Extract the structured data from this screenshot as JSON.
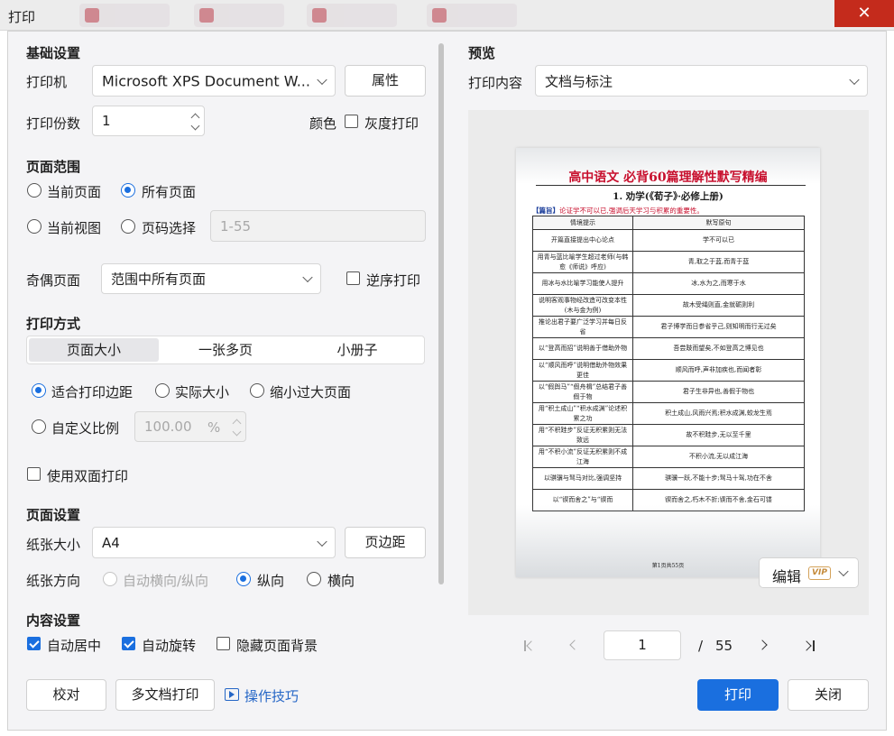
{
  "window": {
    "title": "打印",
    "close_glyph": "✕"
  },
  "left": {
    "basic": {
      "heading": "基础设置",
      "printer_label": "打印机",
      "printer_value": "Microsoft XPS Document W...",
      "properties_button": "属性",
      "copies_label": "打印份数",
      "copies_value": "1",
      "color_label": "颜色",
      "grayscale_label": "灰度打印",
      "grayscale_checked": false
    },
    "range": {
      "heading": "页面范围",
      "current_page": "当前页面",
      "all_pages": "所有页面",
      "current_view": "当前视图",
      "page_select": "页码选择",
      "page_select_placeholder": "1-55",
      "selected": "所有页面"
    },
    "oddeven": {
      "label": "奇偶页面",
      "value": "范围中所有页面",
      "reverse_label": "逆序打印",
      "reverse_checked": false
    },
    "mode": {
      "heading": "打印方式",
      "tabs": [
        "页面大小",
        "一张多页",
        "小册子"
      ],
      "active_tab": "页面大小",
      "fit_margin": "适合打印边距",
      "actual_size": "实际大小",
      "shrink_large": "缩小过大页面",
      "custom_scale": "自定义比例",
      "scale_value": "100.00",
      "scale_unit": "%",
      "duplex_label": "使用双面打印",
      "duplex_checked": false
    },
    "page": {
      "heading": "页面设置",
      "paper_label": "纸张大小",
      "paper_value": "A4",
      "margins_button": "页边距",
      "orientation_label": "纸张方向",
      "auto_orientation": "自动横向/纵向",
      "portrait": "纵向",
      "landscape": "横向",
      "selected": "纵向"
    },
    "content": {
      "heading": "内容设置",
      "auto_center": "自动居中",
      "auto_center_checked": true,
      "auto_rotate": "自动旋转",
      "auto_rotate_checked": true,
      "hide_bg": "隐藏页面背景",
      "hide_bg_checked": false
    }
  },
  "preview": {
    "heading": "预览",
    "content_label": "打印内容",
    "content_value": "文档与标注",
    "document": {
      "title": "高中语文 必背60篇理解性默写精编",
      "subtitle": "1. 劝学(《荀子》·必修上册)",
      "note_tag": "【篇旨】",
      "note": "论证学不可以已,强调后天学习与积累的重要性。",
      "col_left": "情境提示",
      "col_right": "默写原句",
      "rows": [
        [
          "开篇直接提出中心论点",
          "学不可以已"
        ],
        [
          "用青与蓝比喻学生超过老师(与韩愈《师说》呼应)",
          "青,取之于蓝,而青于蓝"
        ],
        [
          "用冰与水比喻学习能使人提升",
          "冰,水为之,而寒于水"
        ],
        [
          "说明客观事物经改造可改变本性(木与金为例)",
          "故木受绳则直,金就砺则利"
        ],
        [
          "推论出君子要广泛学习并每日反省",
          "君子博学而日参省乎己,则知明而行无过矣"
        ],
        [
          "以“登高而招”说明善于借助外物",
          "吾尝跂而望矣,不如登高之博见也"
        ],
        [
          "以“顺风而呼”说明借助外物效果更佳",
          "顺风而呼,声非加疾也,而闻者彰"
        ],
        [
          "以“假舆马”“假舟楫”总结君子善假于物",
          "君子生非异也,善假于物也"
        ],
        [
          "用“积土成山”“积水成渊”论述积累之功",
          "积土成山,风雨兴焉;积水成渊,蛟龙生焉"
        ],
        [
          "用“不积跬步”反证无积累则无法致远",
          "故不积跬步,无以至千里"
        ],
        [
          "用“不积小流”反证无积累则不成江海",
          "不积小流,无以成江海"
        ],
        [
          "以骐骥与驽马对比,强调坚持",
          "骐骥一跃,不能十步;驽马十驾,功在不舍"
        ],
        [
          "以“锲而舍之”与“锲而",
          "锲而舍之,朽木不折;锲而不舍,金石可镂"
        ]
      ],
      "footer": "第1页共55页"
    },
    "edit_button": "编辑",
    "vip_badge": "VIP",
    "pager": {
      "current": "1",
      "separator": "/",
      "total": "55"
    }
  },
  "footer": {
    "proofread": "校对",
    "multi_doc": "多文档打印",
    "tips": "操作技巧",
    "print": "打印",
    "close": "关闭"
  },
  "colors": {
    "accent": "#1a6fdf",
    "title_red": "#c8102e",
    "close_red": "#c42b1c"
  }
}
